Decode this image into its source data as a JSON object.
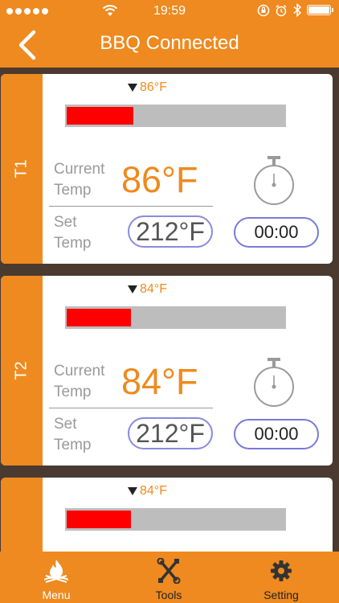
{
  "status_bar": {
    "time": "19:59"
  },
  "nav": {
    "title": "BBQ Connected"
  },
  "probes": [
    {
      "name": "T1",
      "marker_temp": "86°F",
      "progress": 0.3,
      "current_label": "Current\nTemp",
      "current_temp": "86°F",
      "set_label": "Set\nTemp",
      "set_temp": "212°F",
      "timer": "00:00"
    },
    {
      "name": "T2",
      "marker_temp": "84°F",
      "progress": 0.29,
      "current_label": "Current\nTemp",
      "current_temp": "84°F",
      "set_label": "Set\nTemp",
      "set_temp": "212°F",
      "timer": "00:00"
    },
    {
      "name": "",
      "marker_temp": "84°F",
      "progress": 0.29
    }
  ],
  "tab_bar": {
    "items": [
      {
        "label": "Menu",
        "icon": "fire-icon"
      },
      {
        "label": "Tools",
        "icon": "tools-icon"
      },
      {
        "label": "Setting",
        "icon": "gear-icon"
      }
    ]
  },
  "colors": {
    "accent": "#ee8a1f",
    "bar_fill": "#ff0000",
    "bar_track": "#bdbdbd",
    "pill_border": "#8a8ae0"
  }
}
